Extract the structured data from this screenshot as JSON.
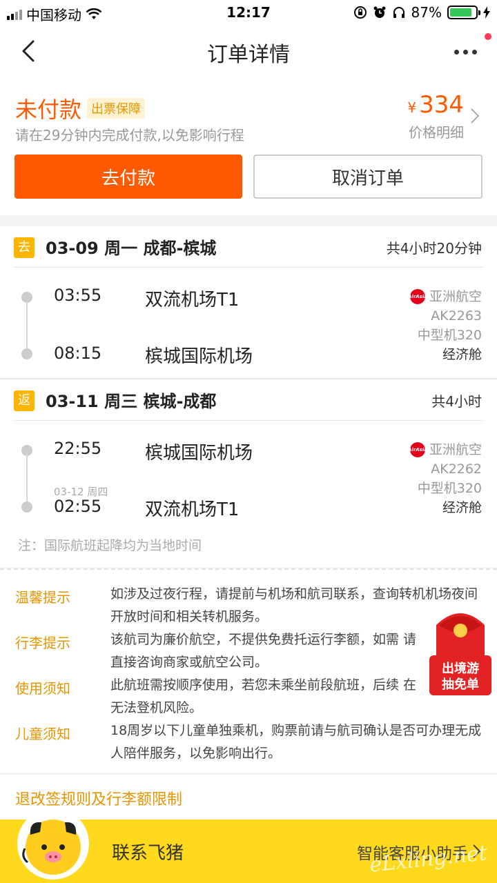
{
  "status_bar": {
    "carrier": "中国移动",
    "time": "12:17",
    "battery": "87%"
  },
  "nav": {
    "title": "订单详情"
  },
  "payment": {
    "status": "未付款",
    "badge": "出票保障",
    "hint": "请在29分钟内完成付款,以免影响行程",
    "currency": "¥",
    "price": "334",
    "price_detail": "价格明细",
    "pay_button": "去付款",
    "cancel_button": "取消订单"
  },
  "segments": [
    {
      "tag": "去",
      "route": "03-09 周一 成都-槟城",
      "duration": "共4小时20分钟",
      "dep_time": "03:55",
      "dep_airport": "双流机场T1",
      "arr_date": "",
      "arr_time": "08:15",
      "arr_airport": "槟城国际机场",
      "airline": "亚洲航空",
      "flight_no": "AK2263",
      "aircraft": "中型机320",
      "cabin": "经济舱"
    },
    {
      "tag": "返",
      "route": "03-11 周三 槟城-成都",
      "duration": "共4小时",
      "dep_time": "22:55",
      "dep_airport": "槟城国际机场",
      "arr_date": "03-12 周四",
      "arr_time": "02:55",
      "arr_airport": "双流机场T1",
      "airline": "亚洲航空",
      "flight_no": "AK2262",
      "aircraft": "中型机320",
      "cabin": "经济舱"
    }
  ],
  "airline_logo_text": "AirAsia",
  "note": "注：国际航班起降均为当地时间",
  "tips": [
    {
      "label": "温馨提示",
      "text": "如涉及过夜行程，请提前与机场和航司联系，查询转机机场夜间开放时间和相关转机服务。"
    },
    {
      "label": "行李提示",
      "text": "该航司为廉价航空，不提供免费托运行李额，如需 请直接咨询商家或航空公司。"
    },
    {
      "label": "使用须知",
      "text": "此航班需按顺序使用，若您未乘坐前段航班，后续 在无法登机风险。"
    },
    {
      "label": "儿童须知",
      "text": "18周岁以下儿童单独乘机，购票前请与航司确认是否可办理无成人陪伴服务，以免影响出行。"
    }
  ],
  "rules_link": "退改签规则及行李额限制",
  "promo": {
    "line1": "出境游",
    "line2": "抽免单"
  },
  "bottom": {
    "contact": "联系飞猪",
    "assistant": "智能客服小助手",
    "watermark": "eLxling.net"
  },
  "colors": {
    "accent_orange": "#ff5a00",
    "tip_orange": "#e69500",
    "bottom_yellow": "#ffd91b",
    "airasia_red": "#e2001a"
  }
}
